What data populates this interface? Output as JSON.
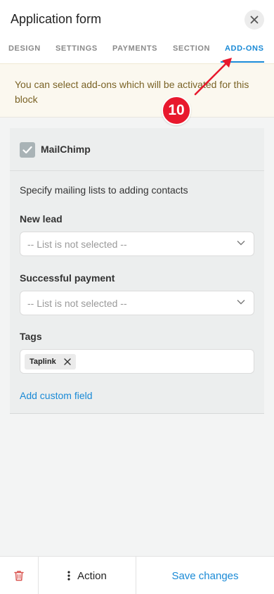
{
  "header": {
    "title": "Application form"
  },
  "tabs": [
    {
      "label": "DESIGN",
      "active": false
    },
    {
      "label": "SETTINGS",
      "active": false
    },
    {
      "label": "PAYMENTS",
      "active": false
    },
    {
      "label": "SECTION",
      "active": false
    },
    {
      "label": "ADD-ONS",
      "active": true
    }
  ],
  "notice": {
    "text": "You can select add-ons which will be activated for this block"
  },
  "annotation": {
    "step": "10"
  },
  "addon": {
    "name": "MailChimp",
    "enabled": true,
    "description": "Specify mailing lists to adding contacts",
    "new_lead": {
      "label": "New lead",
      "value": "-- List is not selected --"
    },
    "successful_payment": {
      "label": "Successful payment",
      "value": "-- List is not selected --"
    },
    "tags": {
      "label": "Tags",
      "items": [
        "Taplink"
      ]
    },
    "custom_field_link": "Add custom field"
  },
  "bottom_bar": {
    "action_label": "Action",
    "save_label": "Save changes"
  },
  "colors": {
    "accent": "#1a8ad6",
    "notice_bg": "#fbf8ef",
    "notice_text": "#7a6326",
    "marker": "#e8182d",
    "danger": "#d9534f"
  },
  "icons": {
    "close": "close-icon",
    "checkbox": "check-icon",
    "select": "chevron-down-icon",
    "tag_remove": "close-icon",
    "delete": "trash-icon",
    "action": "kebab-icon"
  }
}
